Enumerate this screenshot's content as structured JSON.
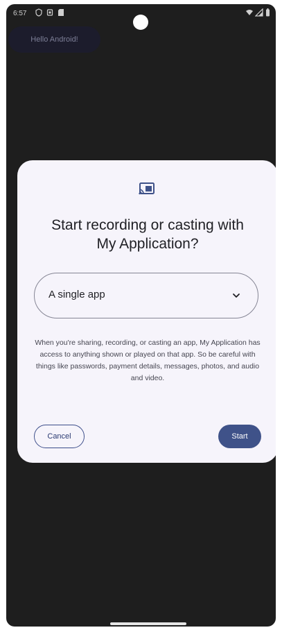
{
  "status_bar": {
    "time": "6:57",
    "left_icons": [
      "vpn-key-icon",
      "notification-icon",
      "sd-card-icon"
    ],
    "right_icons": [
      "wifi-icon",
      "signal-icon",
      "battery-icon"
    ]
  },
  "background_app": {
    "chip_label": "Hello Android!"
  },
  "dialog": {
    "icon": "cast-icon",
    "title_line1": "Start recording or casting with",
    "title_line2": "My Application?",
    "select": {
      "value": "A single app",
      "icon": "chevron-down-icon"
    },
    "body_text": "When you're sharing, recording, or casting an app, My Application has access to anything shown or played on that app. So be careful with things like passwords, payment details, messages, photos, and audio and video.",
    "cancel_label": "Cancel",
    "start_label": "Start",
    "colors": {
      "surface": "#f6f4fb",
      "primary": "#3f5289",
      "outline": "#858594"
    }
  }
}
